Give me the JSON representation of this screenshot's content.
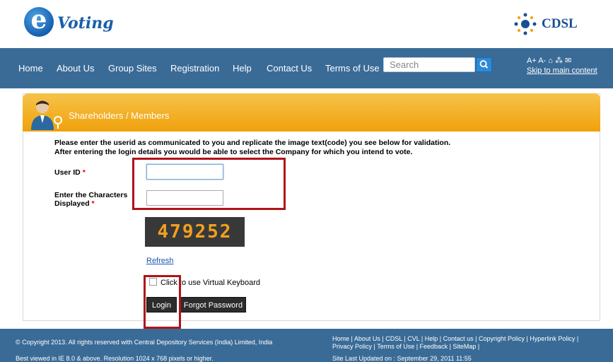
{
  "header": {
    "logo_letter": "e",
    "logo_text": "Voting",
    "brand_text": "CDSL"
  },
  "nav": {
    "items": [
      "Home",
      "About Us",
      "Group Sites",
      "Registration",
      "Help",
      "Contact Us",
      "Terms of Use"
    ],
    "search_placeholder": "Search",
    "tools": "A+  A-  ⌂  ⁂  ✉",
    "skip_link": "Skip to main content"
  },
  "panel": {
    "banner_title": "Shareholders / Members",
    "instruction_1": "Please enter the userid as communicated to you and replicate the image text(code) you see below for validation.",
    "instruction_2": "After entering the login details you would be able to select the Company for which you intend to vote.",
    "userid_label": "User ID",
    "chars_label_1": "Enter the Characters",
    "chars_label_2": "Displayed",
    "required_mark": "*",
    "captcha_text": "479252",
    "refresh_label": "Refresh",
    "virtual_keyboard_label": "Click to use Virtual Keyboard",
    "login_label": "Login",
    "forgot_label": "Forgot Password"
  },
  "footer": {
    "copyright": "© Copyright 2013. All rights reserved with Central Depository Services (India) Limited, India",
    "best_viewed": "Best viewed in IE 8.0 & above. Resolution 1024 x 768 pixels or higher.",
    "links_line_1": "Home | About Us | CDSL | CVL | Help | Contact us | Copyright Policy | Hyperlink Policy |",
    "links_line_2": "Privacy Policy | Terms of Use | Feedback | SiteMap |",
    "updated": "Site Last Updated on : September 29, 2011 11:55"
  },
  "colors": {
    "nav_bg": "#3a6b97",
    "banner": "#f0a10b",
    "highlight_box": "#b0131a"
  }
}
